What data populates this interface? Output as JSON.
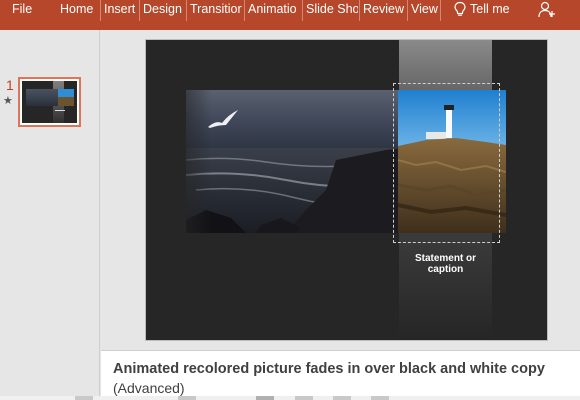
{
  "ribbon": {
    "tabs": [
      {
        "label": "File"
      },
      {
        "label": "Home"
      },
      {
        "label": "Insert"
      },
      {
        "label": "Design"
      },
      {
        "label": "Transitior"
      },
      {
        "label": "Animatio"
      },
      {
        "label": "Slide Sho"
      },
      {
        "label": "Review"
      },
      {
        "label": "View"
      }
    ],
    "tell_me": "Tell me",
    "tell_me_icon": "lightbulb-icon",
    "share_icon": "person-add-icon",
    "color": "#b7472a"
  },
  "thumbnails": [
    {
      "number": "1",
      "animation_marker": "★"
    }
  ],
  "slide": {
    "caption": "Statement or caption"
  },
  "notes": {
    "title": "Animated recolored picture fades in over black and white copy",
    "subtitle": "(Advanced)"
  },
  "status_bar": {
    "icons": [
      "notes-icon",
      "comments-icon",
      "normal-view-icon",
      "slide-sorter-icon",
      "reading-view-icon",
      "slideshow-icon"
    ]
  }
}
